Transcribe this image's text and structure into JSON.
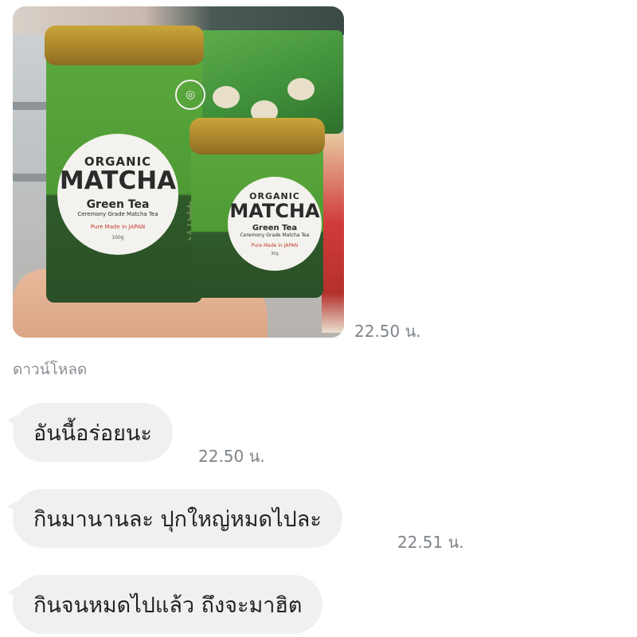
{
  "chat": {
    "photo": {
      "alt": "Organic Matcha Green Tea tins",
      "tin_large": {
        "line1": "ORGANIC",
        "line2": "MATCHA",
        "line3": "Green Tea",
        "line4": "Ceremony Grade Matcha Tea",
        "line5": "Pure Made in JAPAN",
        "weight": "100g"
      },
      "tin_small": {
        "line1": "ORGANIC",
        "line2": "MATCHA",
        "line3": "Green Tea",
        "line4": "Ceremony Grade Matcha Tea",
        "line5": "Pure Made in JAPAN",
        "weight": "30g"
      },
      "time": "22.50 น."
    },
    "download_label": "ดาวน์โหลด",
    "messages": [
      {
        "text": "อันนี้อร่อยนะ",
        "time": "22.50 น."
      },
      {
        "text": "กินมานานละ ปุกใหญ่หมดไปละ",
        "time": "22.51 น."
      },
      {
        "text": "กินจนหมดไปแล้ว ถึงจะมาฮิต",
        "time": ""
      }
    ]
  },
  "colors": {
    "bubble_bg": "#eef0f2",
    "timestamp": "#7e8489",
    "tin_green": "#4e9a34",
    "tin_gold": "#a8832a"
  }
}
